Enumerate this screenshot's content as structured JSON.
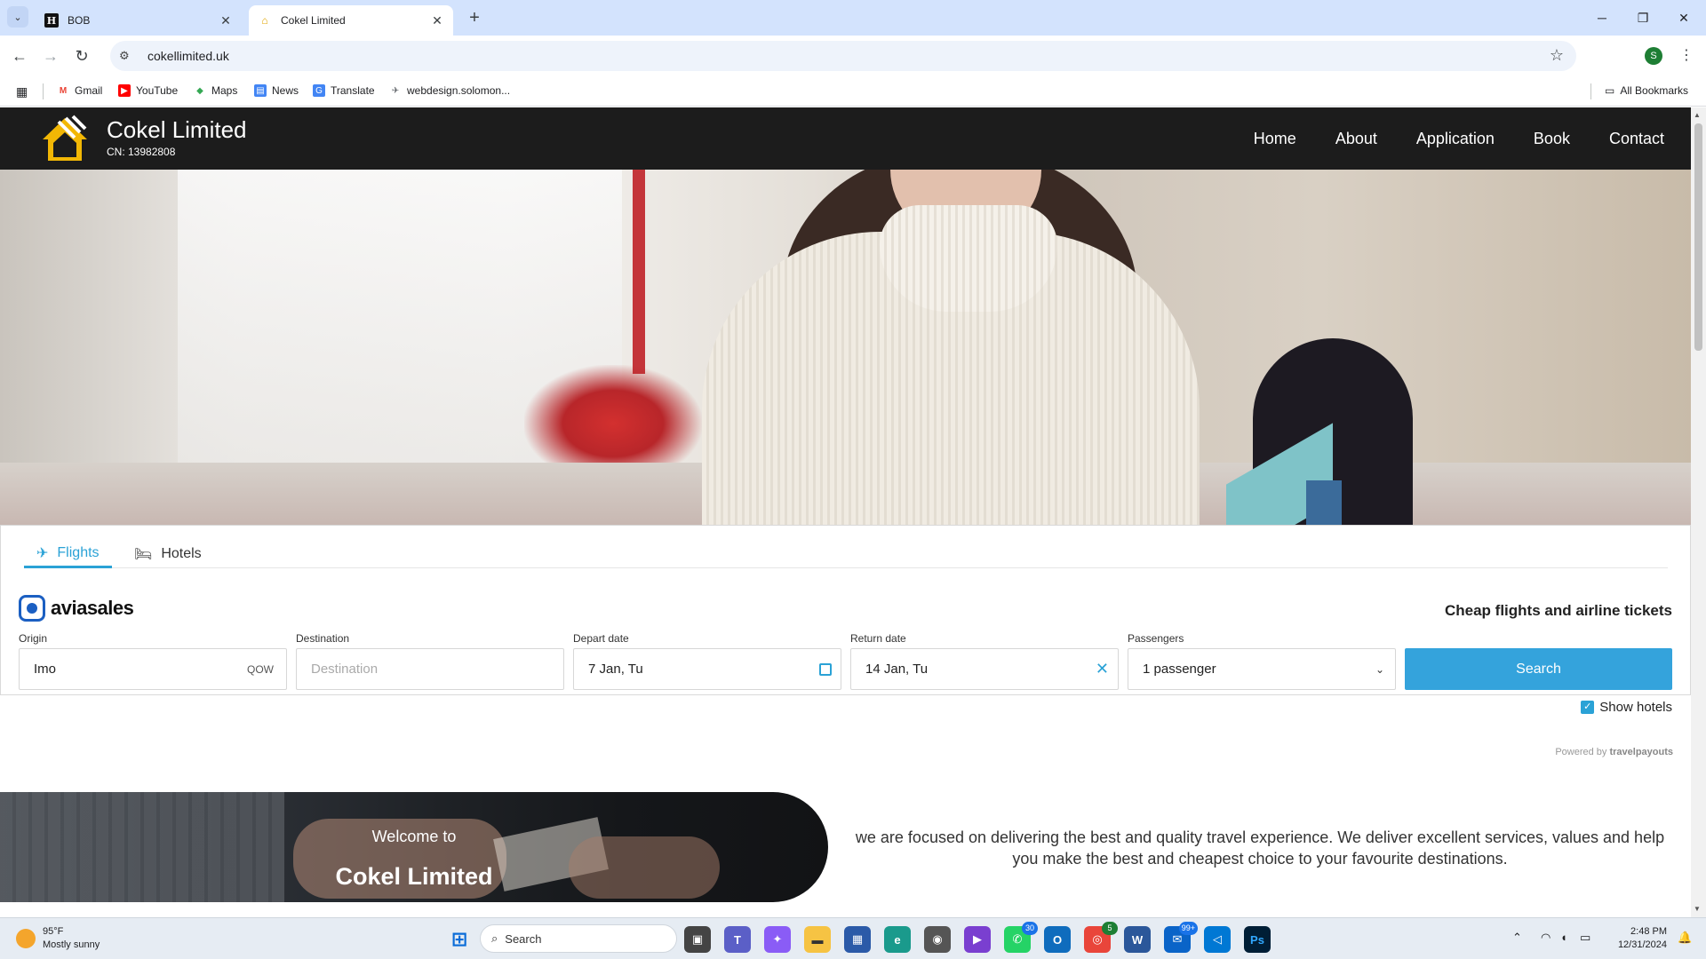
{
  "browser": {
    "tabs": [
      {
        "title": "BOB",
        "favicon": "h-favicon"
      },
      {
        "title": "Cokel Limited",
        "favicon": "cokel-favicon",
        "active": true
      }
    ],
    "url": "cokellimited.uk",
    "profile_initial": "S",
    "bookmarks": [
      "Gmail",
      "YouTube",
      "Maps",
      "News",
      "Translate",
      "webdesign.solomon..."
    ],
    "all_bookmarks_label": "All Bookmarks"
  },
  "site": {
    "brand_name": "Cokel Limited",
    "company_number": "CN: 13982808",
    "nav": [
      "Home",
      "About",
      "Application",
      "Book",
      "Contact"
    ]
  },
  "widget": {
    "tabs": [
      "Flights",
      "Hotels"
    ],
    "active_tab": "Flights",
    "logo_text": "aviasales",
    "tagline": "Cheap flights and airline tickets",
    "origin": {
      "label": "Origin",
      "value": "Imo",
      "code": "QOW"
    },
    "destination": {
      "label": "Destination",
      "placeholder": "Destination"
    },
    "depart": {
      "label": "Depart date",
      "value": "7 Jan, Tu"
    },
    "return": {
      "label": "Return date",
      "value": "14 Jan, Tu"
    },
    "passengers": {
      "label": "Passengers",
      "value": "1 passenger"
    },
    "search_label": "Search",
    "show_hotels_label": "Show hotels",
    "show_hotels_checked": true,
    "powered_prefix": "Powered by",
    "powered_brand": "travelpayouts",
    "accent_color": "#2aa2d6"
  },
  "welcome": {
    "line1": "Welcome to",
    "line2": "Cokel Limited",
    "text": "we are focused on delivering the best and quality travel experience. We deliver excellent services, values and help you make the best and cheapest choice to your favourite destinations."
  },
  "taskbar": {
    "temperature": "95°F",
    "condition": "Mostly sunny",
    "search_placeholder": "Search",
    "whatsapp_badge": "30",
    "chrome_badge": "5",
    "mail_badge": "99+",
    "time": "2:48 PM",
    "date": "12/31/2024"
  }
}
